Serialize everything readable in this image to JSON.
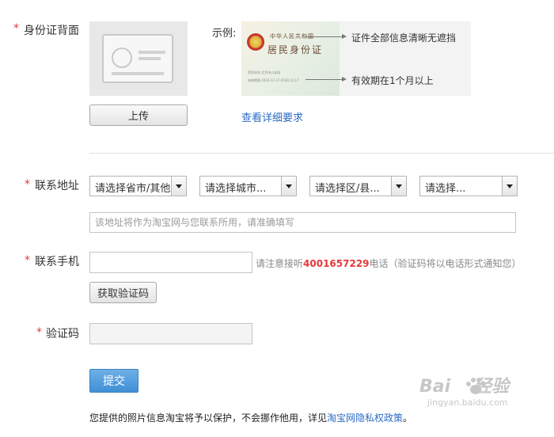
{
  "id_back": {
    "label": "身份证背面",
    "upload_label": "上传",
    "example_label": "示例:",
    "example_card": {
      "line1": "中华人民共和国",
      "line2": "居民身份证",
      "authority_text": "签发机关  北京市公安局",
      "validity_text": "有效期限  2010.12.17-2030.12.17"
    },
    "note_all_info": "证件全部信息清晰无遮挡",
    "note_validity": "有效期在1个月以上",
    "detail_link": "查看详细要求"
  },
  "address": {
    "label": "联系地址",
    "selects": [
      "请选择省市/其他...",
      "请选择城市...",
      "请选择区/县...",
      "请选择..."
    ],
    "detail_placeholder": "该地址将作为淘宝网与您联系所用，请准确填写"
  },
  "phone": {
    "label": "联系手机",
    "value": "",
    "hint_prefix": "请注意接听",
    "hint_number": "4001657229",
    "hint_suffix": "电话（验证码将以电话形式通知您）",
    "get_code_label": "获取验证码"
  },
  "captcha": {
    "label": "验证码",
    "value": ""
  },
  "submit_label": "提交",
  "privacy": {
    "text": "您提供的照片信息淘宝将予以保护，不会挪作他用，详见",
    "link": "淘宝网隐私权政策",
    "end": "。"
  },
  "required_mark": "*",
  "watermark": {
    "main_left": "Bai",
    "main_right": "经验",
    "sub": "jingyan.baidu.com"
  },
  "colors": {
    "required": "#e4393c",
    "link": "#2b6cc4",
    "submit": "#3f8fd6"
  }
}
